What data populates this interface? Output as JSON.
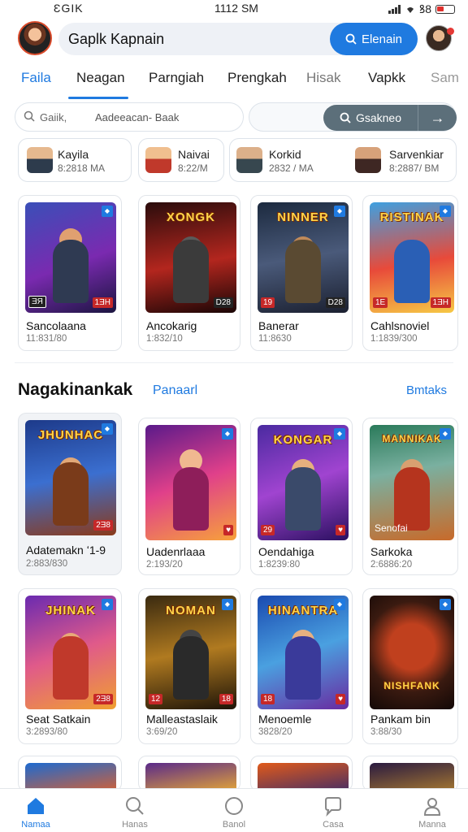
{
  "status_bar": {
    "carrier": "ƐGIΚ",
    "time": "1112 ЅM",
    "battery_label": "ꝸ8"
  },
  "header": {
    "search_query": "Gaplk Kapnain",
    "search_button": "Elenain"
  },
  "tabs": [
    {
      "label": "Faila",
      "active": true
    },
    {
      "label": "Neagan",
      "active": false
    },
    {
      "label": "Parngiah",
      "active": false
    },
    {
      "label": "Prengkah",
      "active": false
    },
    {
      "label": "Hisak",
      "active": false
    },
    {
      "label": "Vapkk",
      "active": false
    },
    {
      "label": "Sam",
      "active": false
    }
  ],
  "filter": {
    "placeholder": "Gaiik,",
    "value": "Aadeeacan- Baak",
    "button": "Gsakneo",
    "arrow": "→"
  },
  "people": [
    {
      "name": "Kayila",
      "time": "8:2818 MA"
    },
    {
      "name": "Naivai",
      "time": "8:22/M"
    },
    {
      "name": "Korkid",
      "time": "2832 / MA"
    },
    {
      "name": "Sarvenkiar",
      "time": "8:2887/ BM"
    }
  ],
  "featured": [
    {
      "title": "Sancolaana",
      "sub": "11:831/80",
      "headline": "",
      "badge_left": "ƎЯ",
      "badge_right": "1ƎH"
    },
    {
      "title": "Ancokarig",
      "sub": "1:832/10",
      "headline": "XONGK",
      "badge_left": "",
      "badge_right": "D28"
    },
    {
      "title": "Banerar",
      "sub": "11:8630",
      "headline": "NINNER",
      "badge_left": "19",
      "badge_right": "D28"
    },
    {
      "title": "Cahlsnoviel",
      "sub": "1:1839/300",
      "headline": "RISTINAK",
      "badge_left": "1E",
      "badge_right": "1ƎH"
    }
  ],
  "section": {
    "title": "Nagakinankak",
    "link": "Panaarl",
    "more": "Bmtaks"
  },
  "grid": [
    {
      "title": "Adatemakn ʻ1-9",
      "sub": "2:883/830",
      "headline": "JHUNHAC",
      "badge_right": "2Ǝ8"
    },
    {
      "title": "Uadenrlaaa",
      "sub": "2:193/20",
      "headline": "",
      "badge_right": "♥"
    },
    {
      "title": "Oendahiga",
      "sub": "1:8239:80",
      "headline": "KONGAR",
      "badge_left": "29",
      "badge_right": "♥"
    },
    {
      "title": "Sarkoka",
      "sub": "2:6886:20",
      "headline": "MANNIKAK",
      "overlay": "Senofai"
    },
    {
      "title": "Seat Satkain",
      "sub": "3:2893/80",
      "headline": "JHINAK",
      "badge_right": "2Ǝ8"
    },
    {
      "title": "Malleastaslaik",
      "sub": "3:69/20",
      "headline": "NOMAN",
      "badge_left": "12",
      "badge_right": "18"
    },
    {
      "title": "Menoemle",
      "sub": "3828/20",
      "headline": "HINANTRA",
      "badge_left": "18",
      "badge_right": "♥"
    },
    {
      "title": "Pankam bin",
      "sub": "3:88/30",
      "headline": "NISHFANK",
      "badge_right": ""
    }
  ],
  "bottom_nav": [
    {
      "label": "Namaa",
      "icon": "home-icon",
      "active": true
    },
    {
      "label": "Hanas",
      "icon": "search-icon",
      "active": false
    },
    {
      "label": "Banol",
      "icon": "circle-icon",
      "active": false
    },
    {
      "label": "Casa",
      "icon": "chat-icon",
      "active": false
    },
    {
      "label": "Manna",
      "icon": "profile-icon",
      "active": false
    }
  ],
  "colors": {
    "accent": "#1f7ae0",
    "filter_button": "#5c6f7a",
    "badge_red": "#c62828"
  }
}
